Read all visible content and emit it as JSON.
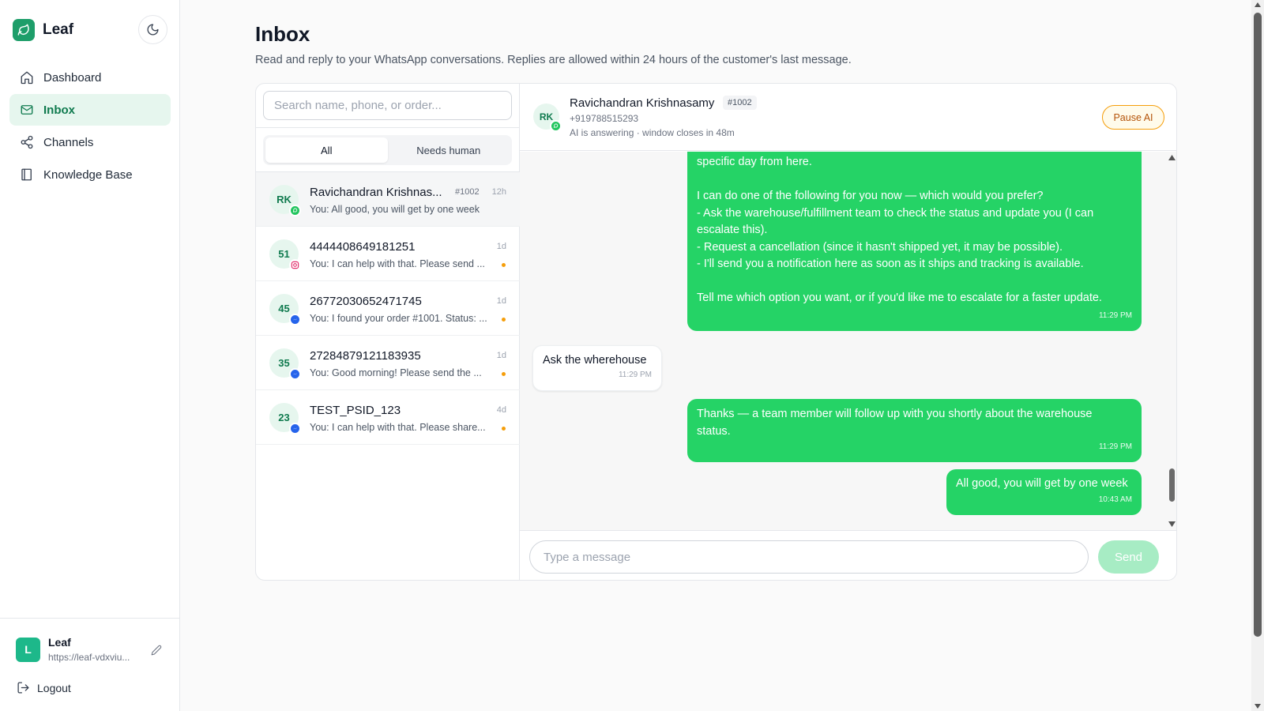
{
  "brand": {
    "name": "Leaf"
  },
  "nav": [
    {
      "label": "Dashboard",
      "icon": "home-icon"
    },
    {
      "label": "Inbox",
      "icon": "inbox-icon"
    },
    {
      "label": "Channels",
      "icon": "share-icon"
    },
    {
      "label": "Knowledge Base",
      "icon": "book-icon"
    }
  ],
  "account": {
    "initial": "L",
    "name": "Leaf",
    "url": "https://leaf-vdxviu...",
    "logout_label": "Logout"
  },
  "page": {
    "title": "Inbox",
    "subtitle": "Read and reply to your WhatsApp conversations. Replies are allowed within 24 hours of the customer's last message."
  },
  "list": {
    "search_placeholder": "Search name, phone, or order...",
    "tabs": [
      "All",
      "Needs human"
    ],
    "conversations": [
      {
        "initials": "RK",
        "name": "Ravichandran Krishnas...",
        "tag": "#1002",
        "time": "12h",
        "preview": "You: All good, you will get by one week",
        "channel": "whatsapp",
        "unread": false
      },
      {
        "initials": "51",
        "name": "4444408649181251",
        "tag": "",
        "time": "1d",
        "preview": "You: I can help with that. Please send ...",
        "channel": "instagram",
        "unread": true
      },
      {
        "initials": "45",
        "name": "26772030652471745",
        "tag": "",
        "time": "1d",
        "preview": "You: I found your order #1001. Status: ...",
        "channel": "messenger",
        "unread": true
      },
      {
        "initials": "35",
        "name": "27284879121183935",
        "tag": "",
        "time": "1d",
        "preview": "You: Good morning! Please send the ...",
        "channel": "messenger",
        "unread": true
      },
      {
        "initials": "23",
        "name": "TEST_PSID_123",
        "tag": "",
        "time": "4d",
        "preview": "You: I can help with that. Please share...",
        "channel": "messenger",
        "unread": true
      }
    ]
  },
  "chat": {
    "initials": "RK",
    "name": "Ravichandran Krishnasamy",
    "tag": "#1002",
    "phone": "+919788515293",
    "status": "AI is answering · window closes in 48m",
    "pause_label": "Pause AI",
    "messages": [
      {
        "dir": "out",
        "lines": [
          "specific day from here.",
          "",
          "I can do one of the following for you now — which would you prefer?",
          "- Ask the warehouse/fulfillment team to check the status and update you (I can",
          "escalate this).",
          "- Request a cancellation (since it hasn't shipped yet, it may be possible).",
          "- I'll send you a notification here as soon as it ships and tracking is available.",
          "",
          "Tell me which option you want, or if you'd like me to escalate for a faster update."
        ],
        "time": "11:29 PM"
      },
      {
        "dir": "in",
        "lines": [
          "Ask the wherehouse"
        ],
        "time": "11:29 PM"
      },
      {
        "dir": "out",
        "lines": [
          "Thanks — a team member will follow up with you shortly about the warehouse",
          "status."
        ],
        "time": "11:29 PM"
      },
      {
        "dir": "out",
        "lines": [
          "All good, you will get by one week"
        ],
        "time": "10:43 AM"
      }
    ],
    "input_placeholder": "Type a message",
    "send_label": "Send"
  },
  "colors": {
    "accent": "#1e9e6a",
    "bubble_out": "#25d366",
    "warning": "#f59e0b"
  }
}
